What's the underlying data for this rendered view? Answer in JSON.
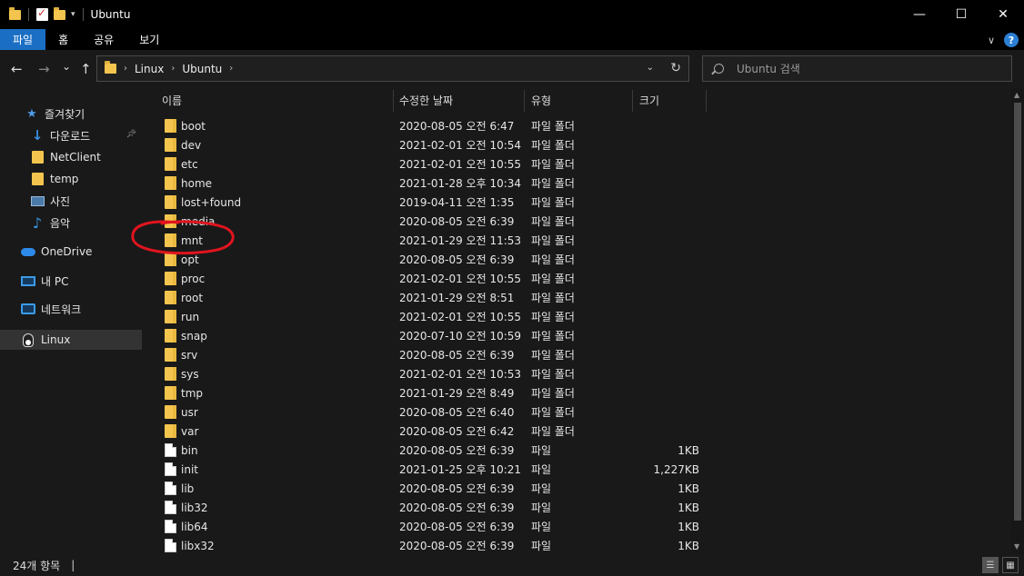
{
  "window": {
    "title": "Ubuntu",
    "minimize": "—",
    "maximize": "☐",
    "close": "✕"
  },
  "ribbon": {
    "tabs": [
      "파일",
      "홈",
      "공유",
      "보기"
    ],
    "expand": "∨",
    "help": "?"
  },
  "nav": {
    "back": "←",
    "forward": "→",
    "recent": "⌄",
    "up": "↑",
    "breadcrumb": [
      "Linux",
      "Ubuntu"
    ],
    "search_placeholder": "Ubuntu 검색"
  },
  "sidebar": {
    "items": [
      {
        "label": "즐겨찾기",
        "icon": "star-icon"
      },
      {
        "label": "다운로드",
        "icon": "download-icon",
        "pinned": true
      },
      {
        "label": "NetClient",
        "icon": "folder-icon"
      },
      {
        "label": "temp",
        "icon": "folder-icon"
      },
      {
        "label": "사진",
        "icon": "pictures-icon"
      },
      {
        "label": "음악",
        "icon": "music-icon"
      },
      {
        "label": "OneDrive",
        "icon": "cloud-icon"
      },
      {
        "label": "내 PC",
        "icon": "computer-icon"
      },
      {
        "label": "네트워크",
        "icon": "network-icon"
      },
      {
        "label": "Linux",
        "icon": "linux-icon",
        "selected": true
      }
    ]
  },
  "columns": {
    "name": "이름",
    "date": "수정한 날짜",
    "type": "유형",
    "size": "크기"
  },
  "files": [
    {
      "name": "boot",
      "date": "2020-08-05 오전 6:47",
      "type": "파일 폴더",
      "size": "",
      "kind": "folder"
    },
    {
      "name": "dev",
      "date": "2021-02-01 오전 10:54",
      "type": "파일 폴더",
      "size": "",
      "kind": "folder"
    },
    {
      "name": "etc",
      "date": "2021-02-01 오전 10:55",
      "type": "파일 폴더",
      "size": "",
      "kind": "folder"
    },
    {
      "name": "home",
      "date": "2021-01-28 오후 10:34",
      "type": "파일 폴더",
      "size": "",
      "kind": "folder"
    },
    {
      "name": "lost+found",
      "date": "2019-04-11 오전 1:35",
      "type": "파일 폴더",
      "size": "",
      "kind": "folder"
    },
    {
      "name": "media",
      "date": "2020-08-05 오전 6:39",
      "type": "파일 폴더",
      "size": "",
      "kind": "folder"
    },
    {
      "name": "mnt",
      "date": "2021-01-29 오전 11:53",
      "type": "파일 폴더",
      "size": "",
      "kind": "folder"
    },
    {
      "name": "opt",
      "date": "2020-08-05 오전 6:39",
      "type": "파일 폴더",
      "size": "",
      "kind": "folder"
    },
    {
      "name": "proc",
      "date": "2021-02-01 오전 10:55",
      "type": "파일 폴더",
      "size": "",
      "kind": "folder"
    },
    {
      "name": "root",
      "date": "2021-01-29 오전 8:51",
      "type": "파일 폴더",
      "size": "",
      "kind": "folder"
    },
    {
      "name": "run",
      "date": "2021-02-01 오전 10:55",
      "type": "파일 폴더",
      "size": "",
      "kind": "folder"
    },
    {
      "name": "snap",
      "date": "2020-07-10 오전 10:59",
      "type": "파일 폴더",
      "size": "",
      "kind": "folder"
    },
    {
      "name": "srv",
      "date": "2020-08-05 오전 6:39",
      "type": "파일 폴더",
      "size": "",
      "kind": "folder"
    },
    {
      "name": "sys",
      "date": "2021-02-01 오전 10:53",
      "type": "파일 폴더",
      "size": "",
      "kind": "folder"
    },
    {
      "name": "tmp",
      "date": "2021-01-29 오전 8:49",
      "type": "파일 폴더",
      "size": "",
      "kind": "folder"
    },
    {
      "name": "usr",
      "date": "2020-08-05 오전 6:40",
      "type": "파일 폴더",
      "size": "",
      "kind": "folder"
    },
    {
      "name": "var",
      "date": "2020-08-05 오전 6:42",
      "type": "파일 폴더",
      "size": "",
      "kind": "folder"
    },
    {
      "name": "bin",
      "date": "2020-08-05 오전 6:39",
      "type": "파일",
      "size": "1KB",
      "kind": "file"
    },
    {
      "name": "init",
      "date": "2021-01-25 오후 10:21",
      "type": "파일",
      "size": "1,227KB",
      "kind": "file"
    },
    {
      "name": "lib",
      "date": "2020-08-05 오전 6:39",
      "type": "파일",
      "size": "1KB",
      "kind": "file"
    },
    {
      "name": "lib32",
      "date": "2020-08-05 오전 6:39",
      "type": "파일",
      "size": "1KB",
      "kind": "file"
    },
    {
      "name": "lib64",
      "date": "2020-08-05 오전 6:39",
      "type": "파일",
      "size": "1KB",
      "kind": "file"
    },
    {
      "name": "libx32",
      "date": "2020-08-05 오전 6:39",
      "type": "파일",
      "size": "1KB",
      "kind": "file"
    }
  ],
  "status": {
    "count": "24개 항목",
    "cursor": "|"
  },
  "colors": {
    "accent": "#1a6fc4",
    "folder": "#f3c54e",
    "annotation": "#e0141e"
  }
}
